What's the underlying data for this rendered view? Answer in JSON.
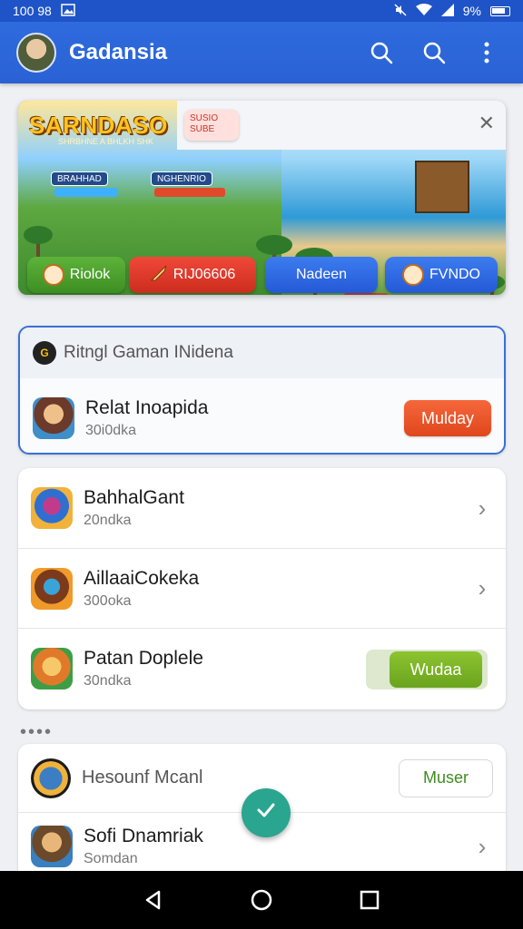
{
  "status_bar": {
    "time": "100 98",
    "battery": "9%"
  },
  "app_bar": {
    "title": "Gadansia"
  },
  "banner": {
    "logo": "SARNDASO",
    "logo_sub": "SHRBHNE A BHLKH SHK",
    "chip": "SUSIO SUBE",
    "hud_left": "BRAHHAD",
    "hud_right": "NGHENRIO",
    "buttons": [
      "Riolok",
      "RIJ06606",
      "Nadeen",
      "FVNDO"
    ]
  },
  "featured": {
    "header": "Ritngl Gaman INidena",
    "item": {
      "title": "Relat Inoapida",
      "sub": "30i0dka",
      "action": "Mulday"
    }
  },
  "list1": [
    {
      "title": "BahhalGant",
      "sub": "20ndka"
    },
    {
      "title": "AillaaiCokeka",
      "sub": "300oka"
    },
    {
      "title": "Patan Doplele",
      "sub": "30ndka",
      "action": "Wudaa"
    }
  ],
  "list2": {
    "header": "Hesounf Mcanl",
    "action": "Muser",
    "item": {
      "title": "Sofi Dnamriak",
      "sub": "Somdan"
    }
  },
  "fab": {
    "icon": "check-icon"
  },
  "colors": {
    "primary": "#2a62d4",
    "accent_orange": "#e8512a",
    "accent_green": "#7cb32a",
    "fab": "#2aa58f"
  }
}
